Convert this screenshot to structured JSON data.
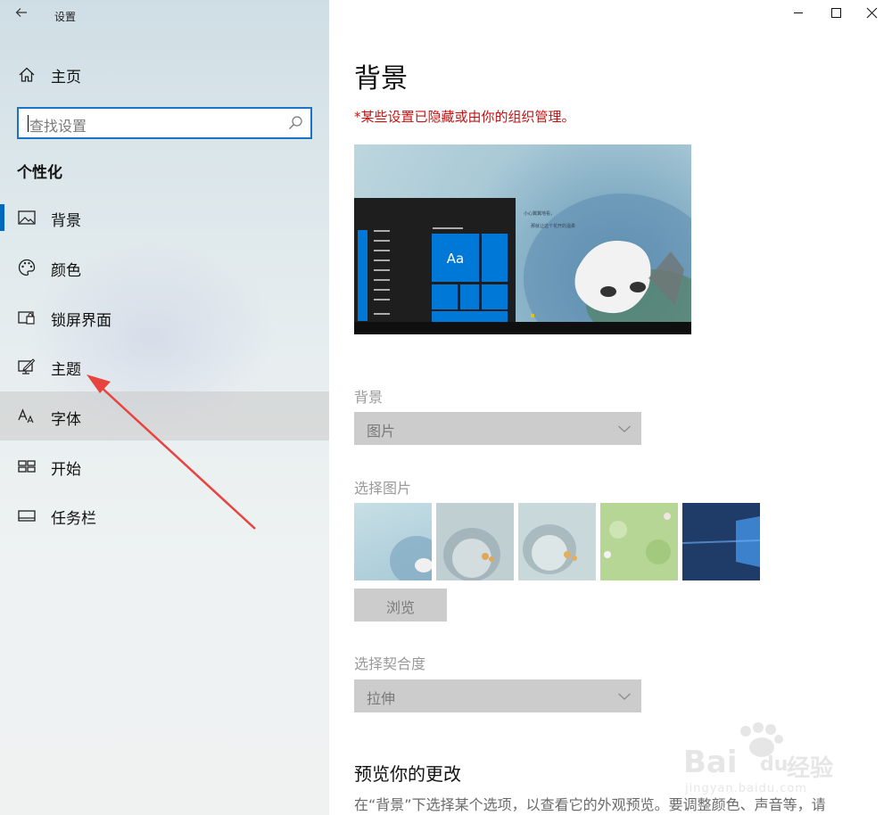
{
  "window": {
    "title": "设置",
    "back_icon": "back-arrow-icon",
    "controls": [
      "minimize-icon",
      "maximize-icon",
      "close-icon"
    ]
  },
  "sidebar": {
    "home_label": "主页",
    "search_placeholder": "查找设置",
    "section_heading": "个性化",
    "items": [
      {
        "label": "背景",
        "icon": "picture-icon",
        "selected": true
      },
      {
        "label": "颜色",
        "icon": "palette-icon"
      },
      {
        "label": "锁屏界面",
        "icon": "lock-screen-icon"
      },
      {
        "label": "主题",
        "icon": "theme-icon"
      },
      {
        "label": "字体",
        "icon": "font-icon",
        "hovered": true
      },
      {
        "label": "开始",
        "icon": "start-icon"
      },
      {
        "label": "任务栏",
        "icon": "taskbar-icon"
      }
    ]
  },
  "main": {
    "title": "背景",
    "warning": "*某些设置已隐藏或由你的组织管理。",
    "preview": {
      "tile_label": "Aa",
      "wallpaper_text_1": "小心翼翼地看，",
      "wallpaper_text_2": "那就让这个花开的温柔"
    },
    "background_label": "背景",
    "background_value": "图片",
    "choose_picture_label": "选择图片",
    "browse_label": "浏览",
    "fit_label": "选择契合度",
    "fit_value": "拉伸",
    "preview_section_title": "预览你的更改",
    "preview_description": "在“背景”下选择某个选项，以查看它的外观预览。要调整颜色、声音等，请"
  },
  "watermark": {
    "brand": "Bai",
    "brand_suffix": "du",
    "cn": "经验",
    "url": "jingyan.baidu.com"
  },
  "colors": {
    "accent": "#0067c0",
    "warning": "#c41414",
    "tile": "#0078d7",
    "disabled_control": "#cccccc"
  }
}
